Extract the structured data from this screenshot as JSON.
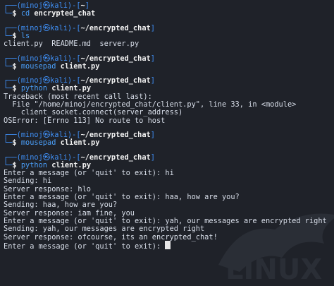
{
  "prompt": {
    "user": "minoj",
    "host": "kali",
    "dollar": "$"
  },
  "blocks": [
    {
      "dir": "~",
      "cmd": "cd",
      "arg": "encrypted_chat"
    },
    {
      "dir": "~/encrypted_chat",
      "cmd": "ls",
      "arg": ""
    },
    {
      "dir": "~/encrypted_chat",
      "cmd": "mousepad",
      "arg": "client.py"
    },
    {
      "dir": "~/encrypted_chat",
      "cmd": "python",
      "arg": "client.py"
    },
    {
      "dir": "~/encrypted_chat",
      "cmd": "mousepad",
      "arg": "client.py"
    },
    {
      "dir": "~/encrypted_chat",
      "cmd": "python",
      "arg": "client.py"
    }
  ],
  "ls_output": "client.py  README.md  server.py",
  "traceback": [
    "Traceback (most recent call last):",
    "  File \"/home/minoj/encrypted_chat/client.py\", line 33, in <module>",
    "    client_socket.connect(server_address)",
    "OSError: [Errno 113] No route to host"
  ],
  "chat_output": [
    "Enter a message (or 'quit' to exit): hi",
    "Sending: hi",
    "Server response: hlo",
    "Enter a message (or 'quit' to exit): haa, how are you?",
    "Sending: haa, how are you?",
    "Server response: iam fine, you",
    "Enter a message (or 'quit' to exit): yah, our messages are encrypted right",
    "Sending: yah, our messages are encrypted right",
    "Server response: ofcourse, its an encrypted_chat!",
    "Enter a message (or 'quit' to exit): "
  ],
  "colors": {
    "background": "#1f2229",
    "prompt_blue": "#3f8ff5",
    "text": "#d8dee9"
  }
}
